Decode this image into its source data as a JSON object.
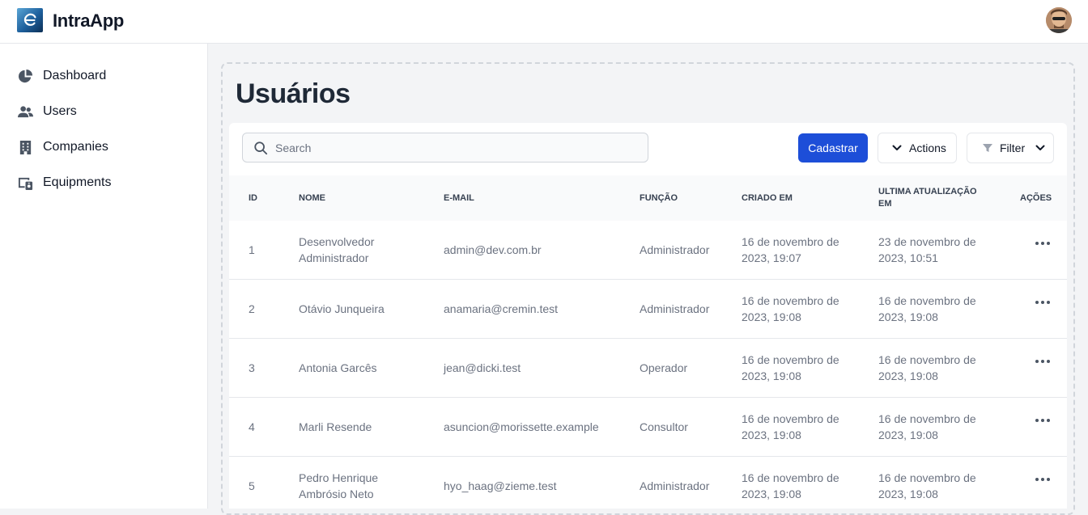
{
  "app": {
    "title": "IntraApp"
  },
  "sidebar": {
    "items": [
      {
        "label": "Dashboard",
        "icon": "pie-chart-icon"
      },
      {
        "label": "Users",
        "icon": "users-icon"
      },
      {
        "label": "Companies",
        "icon": "building-icon"
      },
      {
        "label": "Equipments",
        "icon": "equipment-icon"
      }
    ]
  },
  "page": {
    "title": "Usuários"
  },
  "toolbar": {
    "search_placeholder": "Search",
    "create_label": "Cadastrar",
    "actions_label": "Actions",
    "filter_label": "Filter"
  },
  "table": {
    "headers": {
      "id": "ID",
      "name": "NOME",
      "email": "E-MAIL",
      "role": "FUNÇÃO",
      "created": "CRIADO EM",
      "updated": "ULTIMA ATUALIZAÇÃO EM",
      "actions": "AÇÕES"
    },
    "rows": [
      {
        "id": "1",
        "name": "Desenvolvedor Administrador",
        "email": "admin@dev.com.br",
        "role": "Administrador",
        "created": "16 de novembro de 2023, 19:07",
        "updated": "23 de novembro de 2023, 10:51"
      },
      {
        "id": "2",
        "name": "Otávio Junqueira",
        "email": "anamaria@cremin.test",
        "role": "Administrador",
        "created": "16 de novembro de 2023, 19:08",
        "updated": "16 de novembro de 2023, 19:08"
      },
      {
        "id": "3",
        "name": "Antonia Garcês",
        "email": "jean@dicki.test",
        "role": "Operador",
        "created": "16 de novembro de 2023, 19:08",
        "updated": "16 de novembro de 2023, 19:08"
      },
      {
        "id": "4",
        "name": "Marli Resende",
        "email": "asuncion@morissette.example",
        "role": "Consultor",
        "created": "16 de novembro de 2023, 19:08",
        "updated": "16 de novembro de 2023, 19:08"
      },
      {
        "id": "5",
        "name": "Pedro Henrique Ambrósio Neto",
        "email": "hyo_haag@zieme.test",
        "role": "Administrador",
        "created": "16 de novembro de 2023, 19:08",
        "updated": "16 de novembro de 2023, 19:08"
      }
    ]
  },
  "colors": {
    "primary": "#1d4ed8",
    "text_dark": "#111827",
    "text_muted": "#6b7280"
  }
}
